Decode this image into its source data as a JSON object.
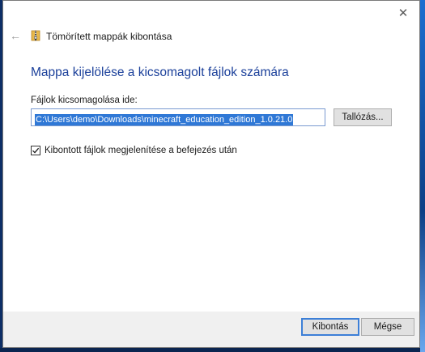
{
  "window": {
    "close_symbol": "✕",
    "back_symbol": "←",
    "icon": "folder-zip-icon",
    "title": "Tömörített mappák kibontása"
  },
  "main": {
    "heading": "Mappa kijelölése a kicsomagolt fájlok számára",
    "field_label": "Fájlok kicsomagolása ide:",
    "path_value": "C:\\Users\\demo\\Downloads\\minecraft_education_edition_1.0.21.0",
    "browse_label": "Tallózás...",
    "show_files_label": "Kibontott fájlok megjelenítése a befejezés után",
    "show_files_checked": true
  },
  "footer": {
    "extract_label": "Kibontás",
    "cancel_label": "Mégse"
  },
  "colors": {
    "heading": "#1a3f9a",
    "selection": "#2f78d6",
    "primary_border": "#3c7fd7"
  }
}
